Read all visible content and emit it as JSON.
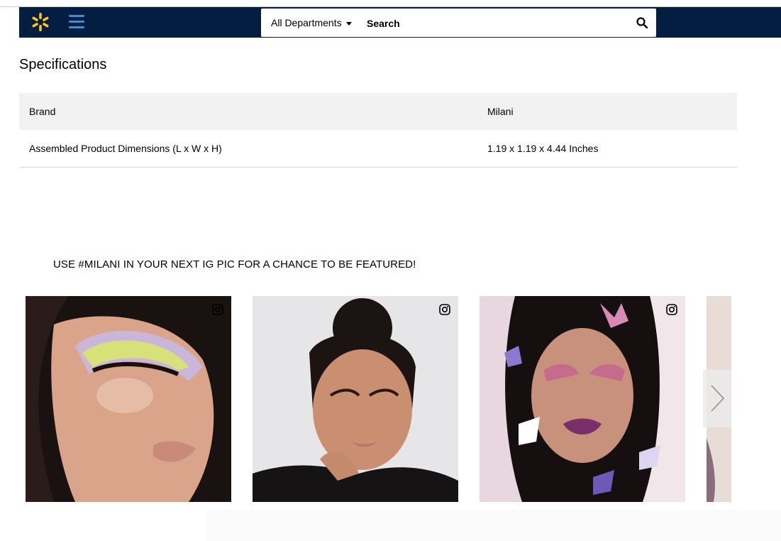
{
  "header": {
    "departments_label": "All Departments",
    "search_placeholder": "Search",
    "logo_icon": "walmart-spark-icon",
    "menu_icon": "hamburger-menu-icon",
    "search_icon": "magnifier-icon",
    "brand_color": "#041e42",
    "spark_color": "#ffc220",
    "menu_color": "#3b8fd9"
  },
  "specifications": {
    "title": "Specifications",
    "rows": [
      {
        "key": "Brand",
        "value": "Milani"
      },
      {
        "key": "Assembled Product Dimensions (L x W x H)",
        "value": "1.19 x 1.19 x 4.44 Inches"
      }
    ]
  },
  "instagram": {
    "heading": "USE #MILANI IN YOUR NEXT IG PIC FOR A CHANCE TO BE FEATURED!",
    "tile_icon": "instagram-icon",
    "next_icon": "chevron-right-icon",
    "tiles": [
      {
        "name": "ig-photo-1"
      },
      {
        "name": "ig-photo-2"
      },
      {
        "name": "ig-photo-3"
      },
      {
        "name": "ig-photo-4"
      }
    ]
  }
}
